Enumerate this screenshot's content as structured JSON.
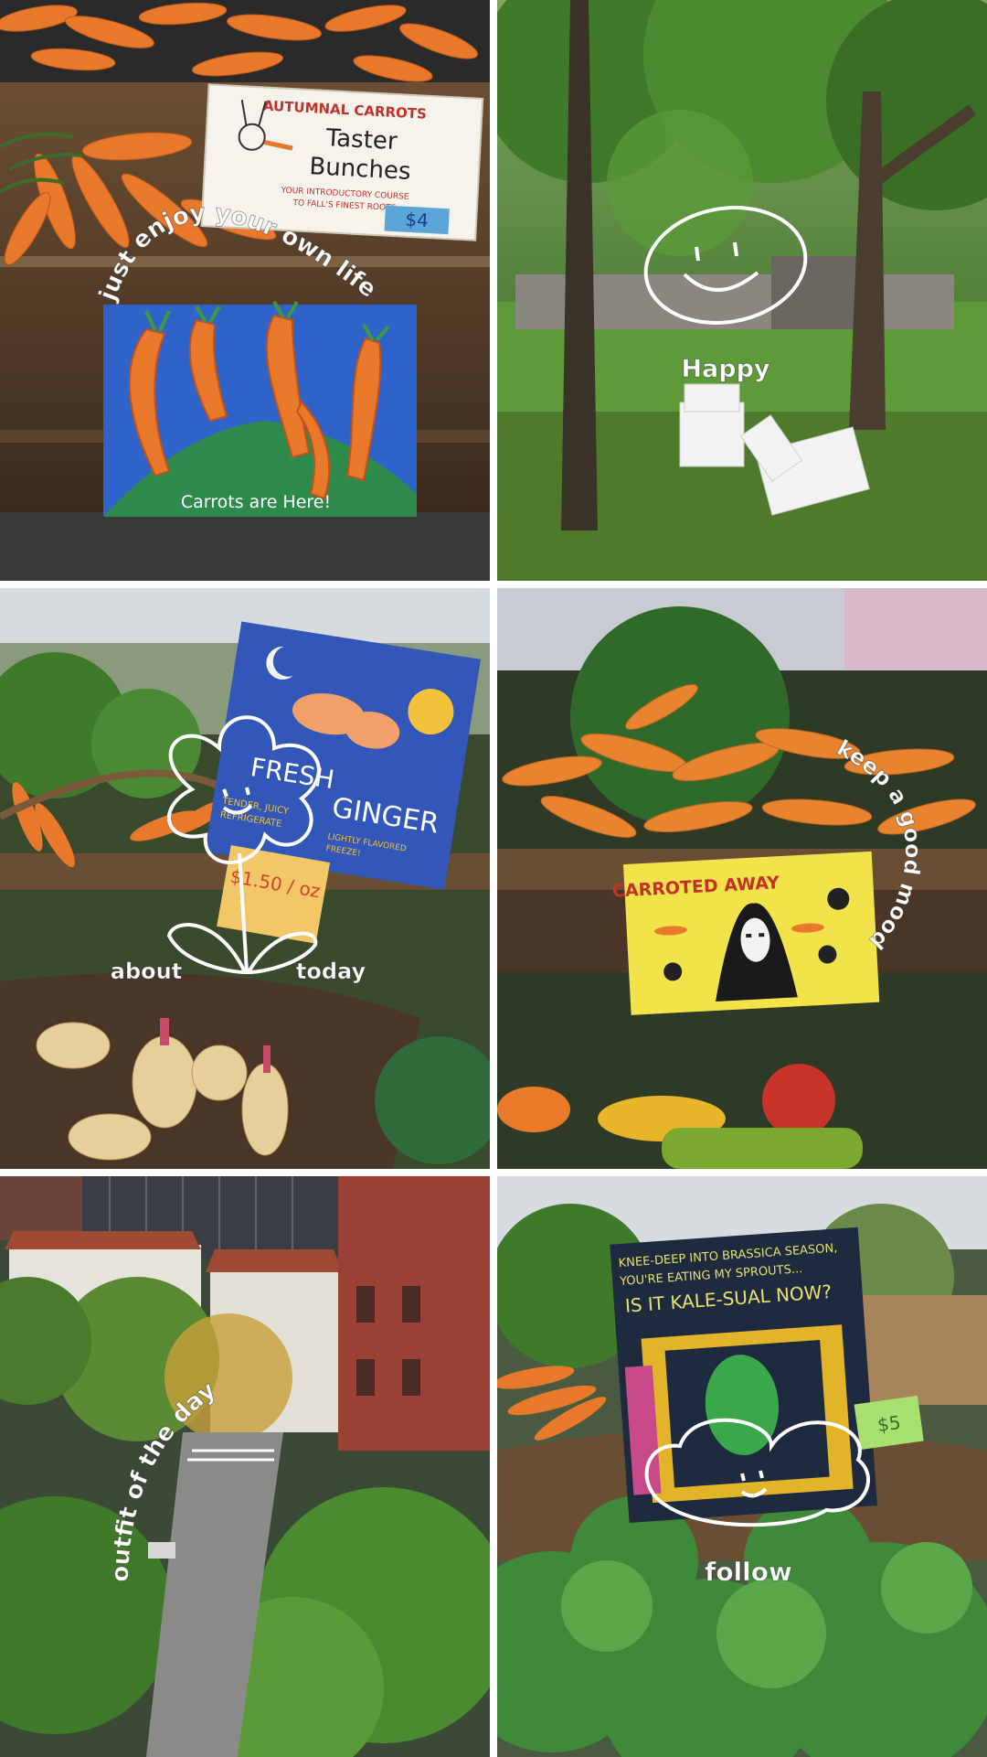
{
  "panels": [
    {
      "overlay": "just enjoy your own life",
      "sign_top": {
        "line1": "AUTUMNAL CARROTS",
        "line2": "Taster",
        "line3": "Bunches",
        "line4": "YOUR INTRODUCTORY COURSE",
        "line5": "TO FALL'S FINEST ROOTS",
        "price": "$4"
      },
      "sign_bottom": "Carrots are Here!"
    },
    {
      "overlay": "Happy"
    },
    {
      "overlay_left": "about",
      "overlay_right": "today",
      "sign": {
        "title1": "FRESH",
        "title2": "GINGER",
        "sub1": "TENDER, JUICY",
        "sub2": "REFRIGERATE",
        "sub3": "LIGHTLY FLAVORED",
        "sub4": "FREEZE!",
        "price": "$1.50 / oz"
      }
    },
    {
      "overlay": "keep a good mood",
      "sign": "CARROTED AWAY"
    },
    {
      "overlay": "outfit of the day"
    },
    {
      "overlay": "follow",
      "sign": {
        "line1": "KNEE-DEEP INTO BRASSICA SEASON,",
        "line2": "YOU'RE EATING MY SPROUTS...",
        "line3": "IS IT KALE-SUAL NOW?"
      },
      "price": "$5"
    }
  ],
  "colors": {
    "carrot": "#e8782a",
    "overlay_text": "#ffffff",
    "grass": "#5f9a3a",
    "sign_blue": "#2e4fb5",
    "sign_yellow": "#f2e34a"
  }
}
